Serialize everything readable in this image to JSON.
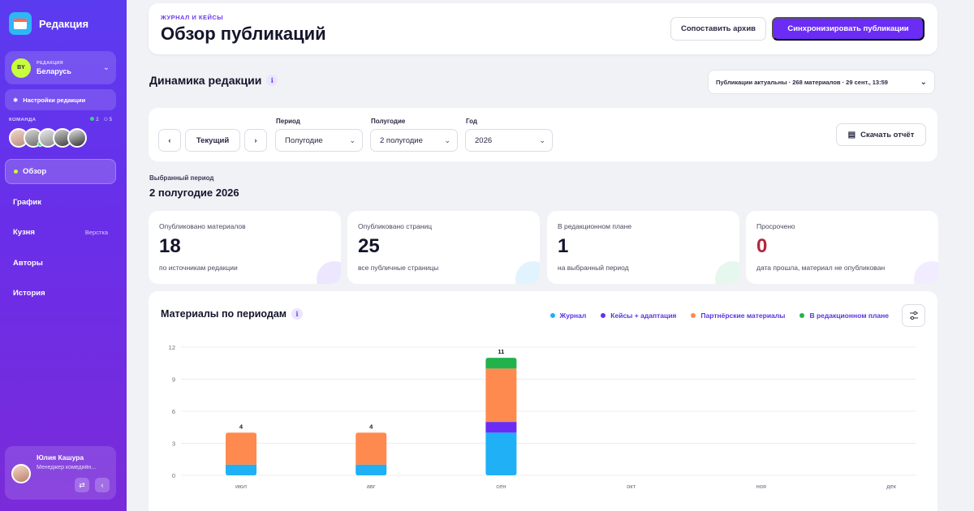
{
  "sidebar": {
    "brand": "Редакция",
    "org": {
      "initials": "BY",
      "label": "РЕДАКЦИЯ",
      "name": "Беларусь"
    },
    "settings_label": "Настройки редакции",
    "team": {
      "label": "КОМАНДА",
      "online": "2",
      "members": "5"
    },
    "nav": [
      {
        "label": "Обзор",
        "active": true
      },
      {
        "label": "График"
      },
      {
        "label": "Кузня",
        "badge": "Верстка"
      },
      {
        "label": "Авторы"
      },
      {
        "label": "История"
      }
    ],
    "user": {
      "name": "Юлия Кашура",
      "role": "Менеджер комедийн..."
    }
  },
  "header": {
    "eyebrow": "ЖУРНАЛ И КЕЙСЫ",
    "title": "Обзор публикаций",
    "compare_label": "Сопоставить архив",
    "sync_label": "Синхронизировать публикации"
  },
  "section": {
    "title": "Динамика редакции",
    "status": "Публикации актуальны · 268 материалов · 29 сент., 13:59"
  },
  "filters": {
    "current_label": "Текущий",
    "period_label": "Период",
    "period_value": "Полугодие",
    "half_label": "Полугодие",
    "half_value": "2 полугодие",
    "year_label": "Год",
    "year_value": "2026",
    "download_label": "Скачать отчёт"
  },
  "selected": {
    "label": "Выбранный период",
    "value": "2 полугодие 2026"
  },
  "kpis": [
    {
      "label": "Опубликовано материалов",
      "value": "18",
      "sub": "по источникам редакции",
      "value_color": "#14142b",
      "deco_color": "#c9b8ff"
    },
    {
      "label": "Опубликовано страниц",
      "value": "25",
      "sub": "все публичные страницы",
      "value_color": "#14142b",
      "deco_color": "#a9dcff"
    },
    {
      "label": "В редакционном плане",
      "value": "1",
      "sub": "на выбранный период",
      "value_color": "#14142b",
      "deco_color": "#b7eccb"
    },
    {
      "label": "Просрочено",
      "value": "0",
      "sub": "дата прошла, материал не опубликован",
      "value_color": "#b0283c",
      "deco_color": "#d6c8ff"
    }
  ],
  "chart": {
    "title": "Материалы по периодам"
  },
  "chart_data": {
    "type": "bar",
    "stacked": true,
    "categories": [
      "июл",
      "авг",
      "сен",
      "окт",
      "ноя",
      "дек"
    ],
    "series": [
      {
        "name": "Журнал",
        "color": "#1fb0f5",
        "values": [
          1,
          1,
          4,
          0,
          0,
          0
        ]
      },
      {
        "name": "Кейсы + адаптация",
        "color": "#6b2cf5",
        "values": [
          0,
          0,
          1,
          0,
          0,
          0
        ]
      },
      {
        "name": "Партнёрские материалы",
        "color": "#ff8a4f",
        "values": [
          3,
          3,
          5,
          0,
          0,
          0
        ]
      },
      {
        "name": "В редакционном плане",
        "color": "#22b24c",
        "values": [
          0,
          0,
          1,
          0,
          0,
          0
        ]
      }
    ],
    "totals": [
      4,
      4,
      11,
      null,
      null,
      null
    ],
    "yticks": [
      0,
      3,
      6,
      9,
      12
    ],
    "ylim": [
      0,
      12
    ],
    "grid": true,
    "legend": "top-right"
  }
}
